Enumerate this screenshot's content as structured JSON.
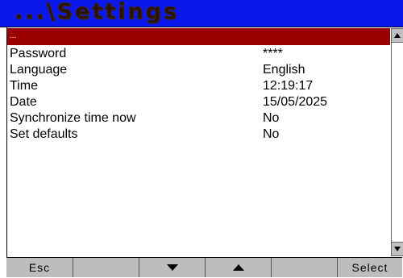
{
  "window": {
    "title": "...\\Settings"
  },
  "list": {
    "selected_item": "...",
    "items": [
      {
        "label": "Password",
        "value": "****"
      },
      {
        "label": "Language",
        "value": "English"
      },
      {
        "label": "Time",
        "value": "12:19:17"
      },
      {
        "label": "Date",
        "value": "15/05/2025"
      },
      {
        "label": "Synchronize time now",
        "value": "No"
      },
      {
        "label": "Set defaults",
        "value": "No"
      }
    ]
  },
  "softkeys": {
    "esc": "Esc",
    "key2": "",
    "down_icon": "arrow-down",
    "up_icon": "arrow-up",
    "key5": "",
    "select": "Select"
  },
  "colors": {
    "titlebar": "#0a18ec",
    "selection": "#9b0000",
    "softkey_bg": "#bdbdbd"
  }
}
